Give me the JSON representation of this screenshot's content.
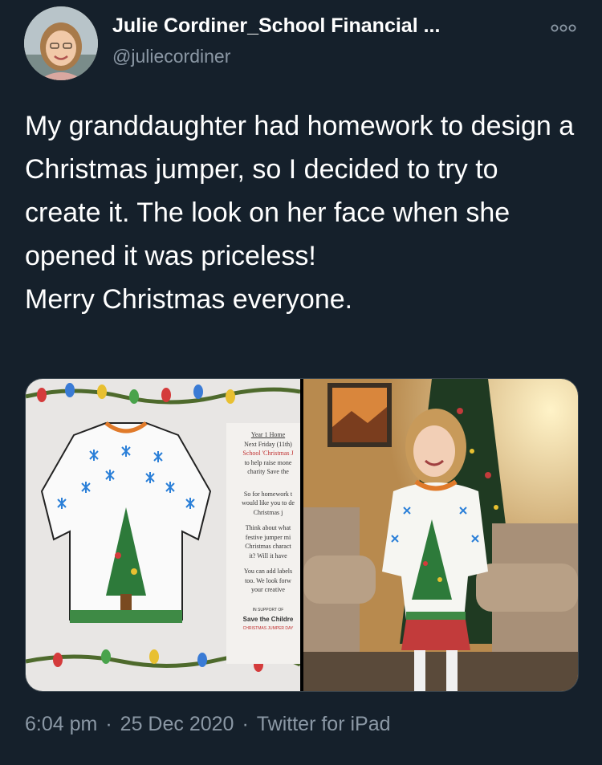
{
  "tweet": {
    "display_name": "Julie Cordiner_School Financial ...",
    "handle": "@juliecordiner",
    "text": "My granddaughter had homework to design a Christmas jumper, so I decided to try to create it. The look on her face when she opened it was priceless!\nMerry Christmas everyone.",
    "time": "6:04 pm",
    "date": "25 Dec 2020",
    "source": "Twitter for iPad",
    "separator": "·"
  },
  "media": {
    "worksheet": {
      "heading": "Year 1 Home",
      "lines": [
        "Next Friday (11th)",
        "School 'Christmas J",
        "to help raise mone",
        "charity Save the",
        "So for homework t",
        "would like you to de",
        "Christmas j",
        "Think about what",
        "festive jumper mi",
        "Christmas charact",
        "it? Will it have",
        "You can add labels",
        "too. We look forw",
        "your creative"
      ],
      "charity_label": "Save the Childre",
      "charity_sub": "CHRISTMAS JUMPER DAY",
      "support_label": "IN SUPPORT OF"
    }
  },
  "colors": {
    "background": "#15202b",
    "secondary_text": "#8b98a5",
    "border": "#38444d"
  },
  "icons": {
    "more": "more-horizontal-icon"
  }
}
